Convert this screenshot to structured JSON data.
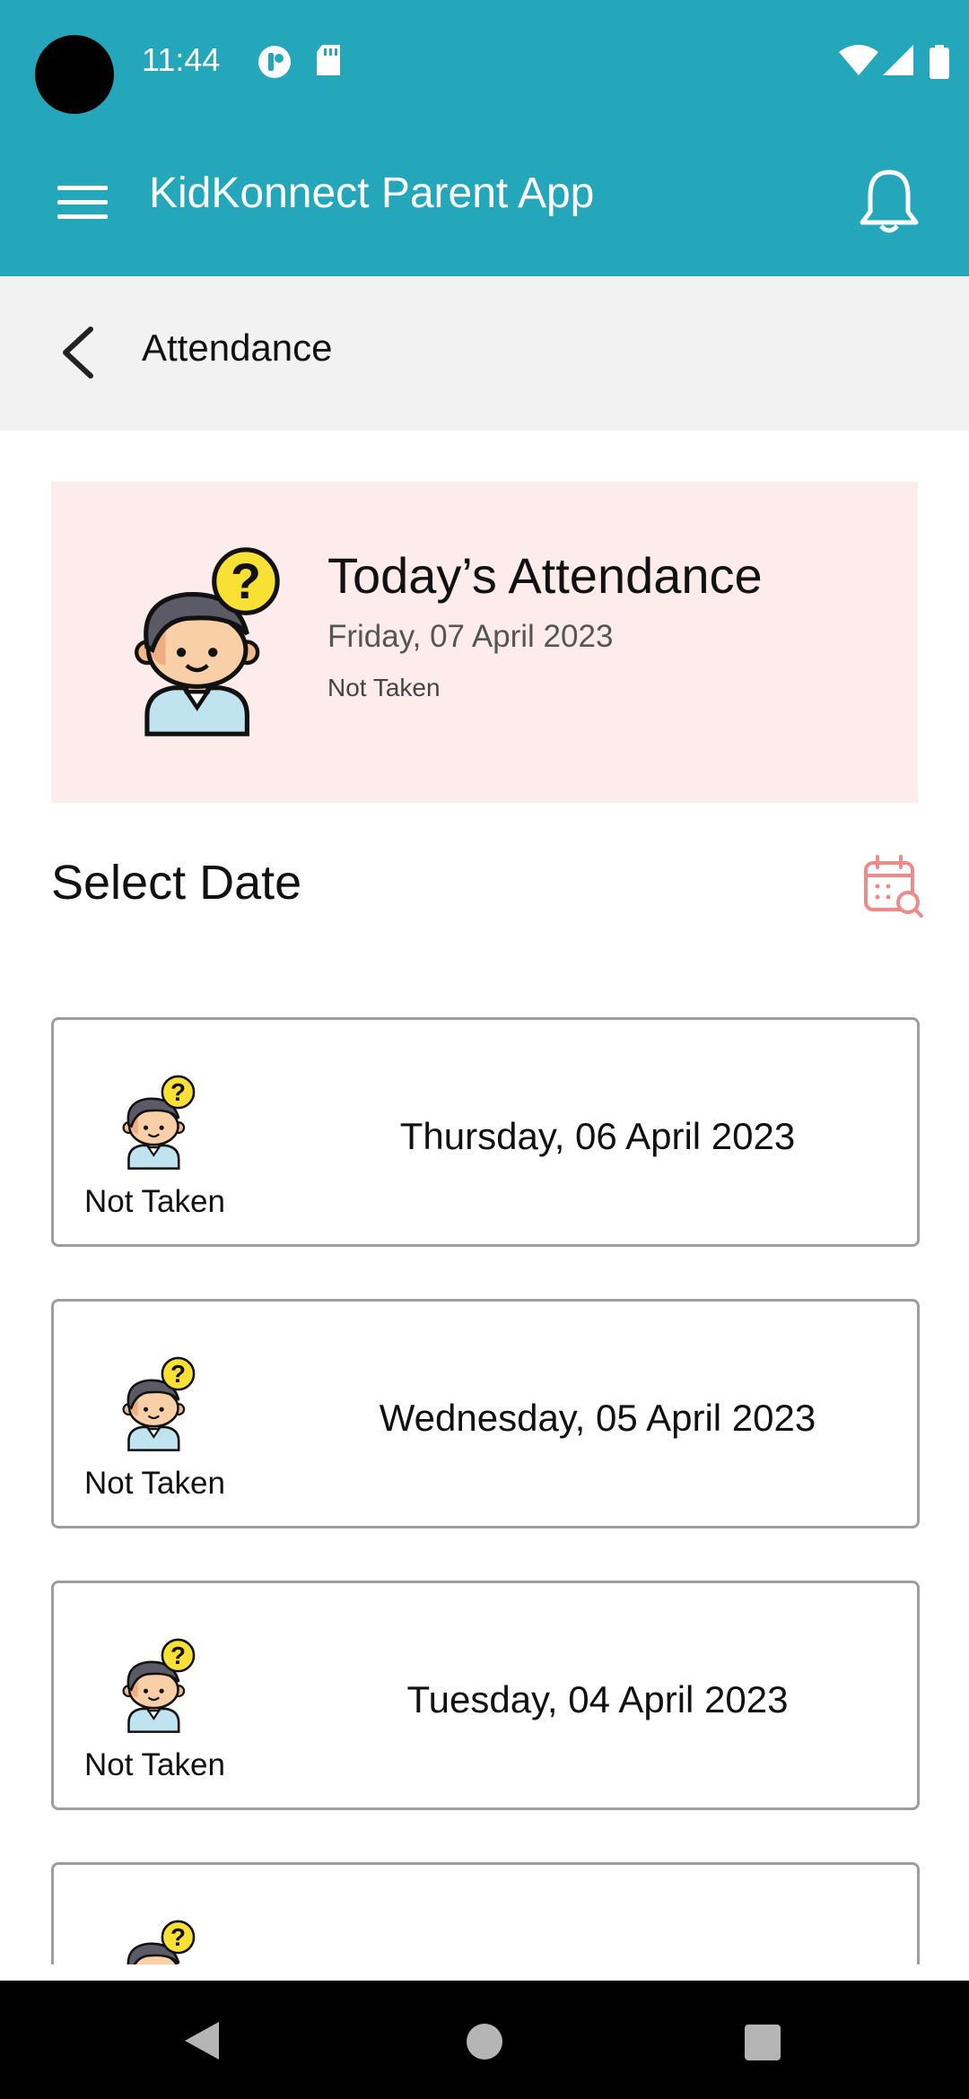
{
  "status_bar": {
    "time": "11:44",
    "icons": [
      "tracker-icon",
      "sd-card-icon",
      "wifi-icon",
      "signal-icon",
      "battery-icon"
    ]
  },
  "app_bar": {
    "title": "KidKonnect Parent App",
    "menu_icon": "menu-icon",
    "bell_icon": "bell-icon"
  },
  "sub_bar": {
    "back_icon": "chevron-left-icon",
    "title": "Attendance"
  },
  "today": {
    "title": "Today’s Attendance",
    "date": "Friday, 07 April 2023",
    "status": "Not Taken",
    "icon": "student-question-icon"
  },
  "select_date": {
    "label": "Select Date",
    "icon": "calendar-search-icon"
  },
  "days": [
    {
      "date": "Thursday, 06 April 2023",
      "status": "Not Taken"
    },
    {
      "date": "Wednesday, 05 April 2023",
      "status": "Not Taken"
    },
    {
      "date": "Tuesday, 04 April 2023",
      "status": "Not Taken"
    },
    {
      "date": "",
      "status": ""
    }
  ],
  "colors": {
    "primary": "#24a6bb",
    "today_card_bg": "#fdeceb",
    "calendar_icon": "#f08a8a",
    "question_badge": "#f9e035"
  }
}
